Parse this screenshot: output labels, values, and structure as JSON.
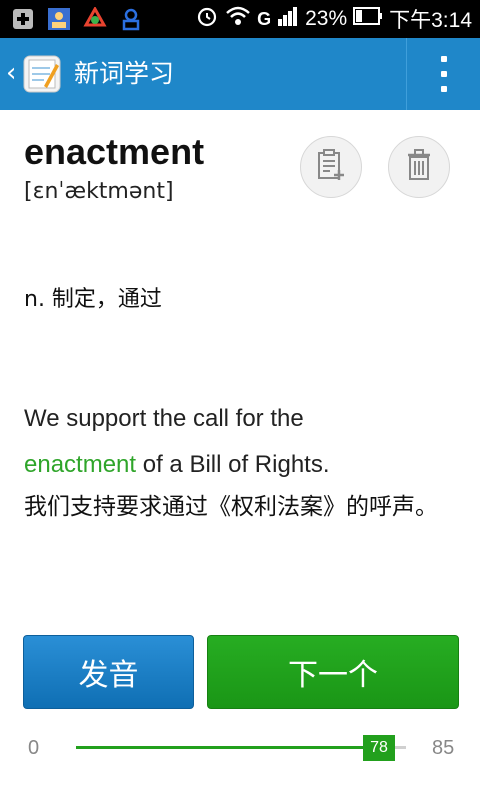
{
  "status_bar": {
    "battery": "23%",
    "time": "下午3:14",
    "network": "G",
    "icons": [
      "plus-icon",
      "contacts-icon",
      "recycle-icon",
      "person-tag-icon",
      "alarm-icon",
      "wifi-icon",
      "signal-icon",
      "battery-icon"
    ]
  },
  "action_bar": {
    "back": "‹",
    "title": "新词学习",
    "icons": [
      "app-icon",
      "overflow-menu-icon"
    ]
  },
  "card": {
    "word": "enactment",
    "phonetic": "[ɛnˈæktmənt]",
    "definition": "n. 制定，通过",
    "example_before": "We support the call for the",
    "example_highlight": "enactment",
    "example_after": "of a Bill of Rights.",
    "translation": "我们支持要求通过《权利法案》的呼声。",
    "actions": [
      "add-note-icon",
      "trash-icon"
    ]
  },
  "buttons": {
    "pronounce": "发音",
    "next": "下一个"
  },
  "progress": {
    "min": "0",
    "max": "85",
    "value": 78,
    "value_label": "78"
  },
  "colors": {
    "action_bar": "#1f87c9",
    "accent_green": "#2fa52a",
    "button_blue": "#1a7fc5",
    "button_green": "#1fa11a"
  }
}
